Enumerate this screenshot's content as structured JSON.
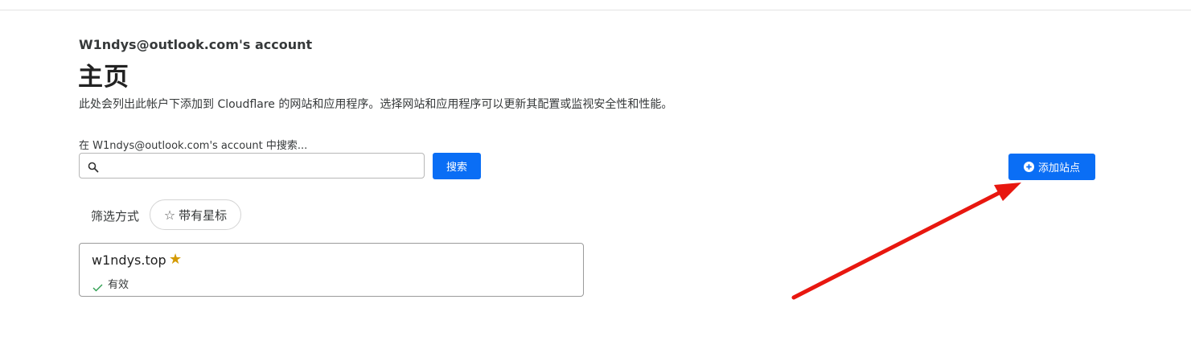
{
  "header": {
    "account_title": "W1ndys@outlook.com's account",
    "page_title": "主页",
    "description": "此处会列出此帐户下添加到 Cloudflare 的网站和应用程序。选择网站和应用程序可以更新其配置或监视安全性和性能。"
  },
  "search": {
    "label": "在 W1ndys@outlook.com's account 中搜索...",
    "value": "",
    "placeholder": "",
    "button_label": "搜索",
    "icon": "search-icon"
  },
  "add_site": {
    "label": "添加站点",
    "icon": "plus-circle-icon"
  },
  "filter": {
    "label": "筛选方式",
    "chip_label": "带有星标",
    "chip_icon": "star-outline-icon"
  },
  "sites": [
    {
      "domain": "w1ndys.top",
      "starred": true,
      "status": "有效",
      "status_icon": "check-icon"
    }
  ],
  "colors": {
    "primary": "#0a6ef5",
    "star": "#d49a00",
    "status_ok": "#2e9e4f",
    "annotation_arrow": "#e8170f"
  }
}
